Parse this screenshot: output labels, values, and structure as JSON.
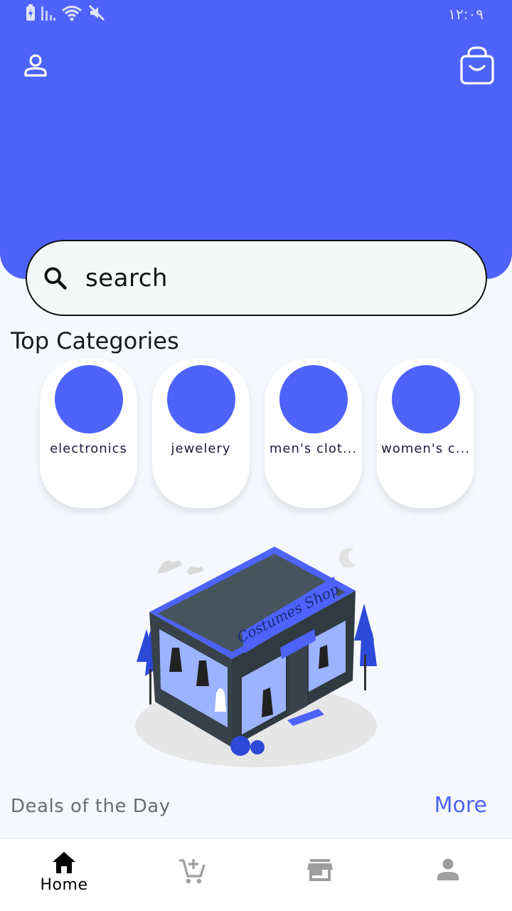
{
  "status_bar": {
    "time": "۱۲:۰۹"
  },
  "header": {
    "profile_icon": "person-outline-icon",
    "cart_icon": "shopping-bag-icon"
  },
  "search": {
    "placeholder": "search",
    "icon": "search-icon"
  },
  "top_categories": {
    "title": "Top Categories",
    "items": [
      {
        "label": "electronics"
      },
      {
        "label": "jewelery"
      },
      {
        "label": "men's clot..."
      },
      {
        "label": "women's c..."
      }
    ]
  },
  "illustration": {
    "sign_text": "Costumes Shop"
  },
  "deals": {
    "title": "Deals of the Day",
    "more_label": "More"
  },
  "bottom_nav": {
    "items": [
      {
        "label": "Home",
        "icon": "home-icon",
        "active": true
      },
      {
        "label": "",
        "icon": "add-to-cart-icon",
        "active": false
      },
      {
        "label": "",
        "icon": "store-icon",
        "active": false
      },
      {
        "label": "",
        "icon": "person-icon",
        "active": false
      }
    ]
  },
  "colors": {
    "accent": "#4d63fb",
    "background": "#f5f9fd",
    "inactive_icon": "#9e9e9e"
  }
}
